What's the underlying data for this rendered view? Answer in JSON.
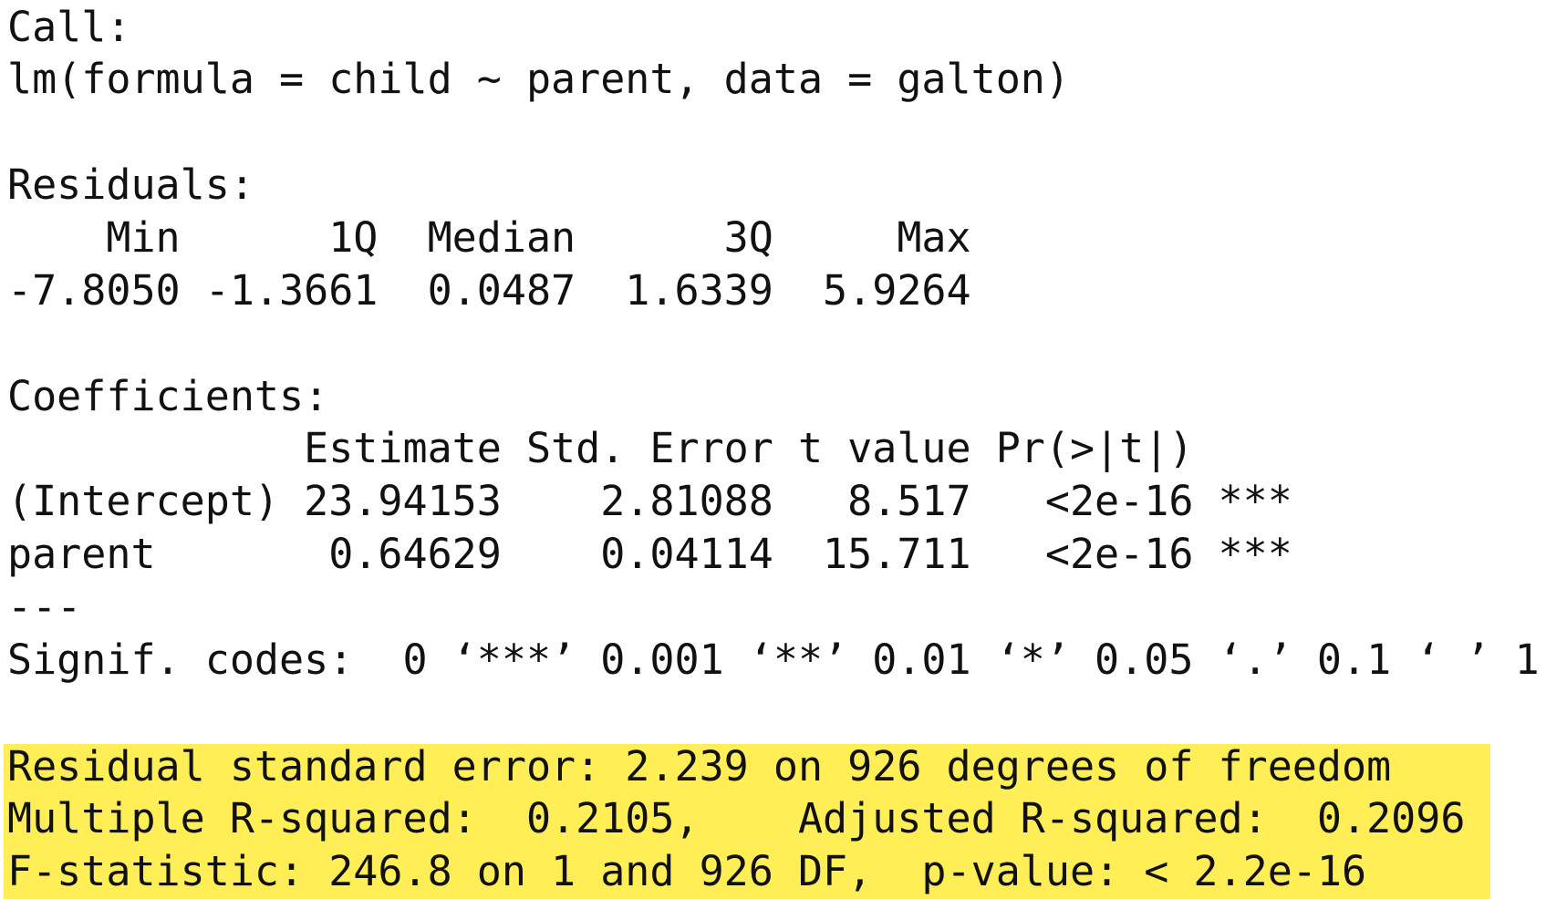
{
  "highlight_color": "#ffee55",
  "call": {
    "header": "Call:",
    "formula": "lm(formula = child ~ parent, data = galton)"
  },
  "residuals": {
    "header": "Residuals:",
    "labels_line": "    Min      1Q  Median      3Q     Max",
    "values_line": "-7.8050 -1.3661  0.0487  1.6339  5.9264",
    "stats": {
      "Min": -7.805,
      "1Q": -1.3661,
      "Median": 0.0487,
      "3Q": 1.6339,
      "Max": 5.9264
    }
  },
  "coefficients": {
    "header": "Coefficients:",
    "columns_line": "            Estimate Std. Error t value Pr(>|t|)",
    "rows": [
      {
        "line": "(Intercept) 23.94153    2.81088   8.517   <2e-16 ***",
        "term": "(Intercept)",
        "estimate": "23.94153",
        "std_error": "2.81088",
        "t_value": "8.517",
        "p": "<2e-16",
        "signif": "***"
      },
      {
        "line": "parent       0.64629    0.04114  15.711   <2e-16 ***",
        "term": "parent",
        "estimate": "0.64629",
        "std_error": "0.04114",
        "t_value": "15.711",
        "p": "<2e-16",
        "signif": "***"
      }
    ]
  },
  "separator": "---",
  "signif_codes": "Signif. codes:  0 ‘***’ 0.001 ‘**’ 0.01 ‘*’ 0.05 ‘.’ 0.1 ‘ ’ 1",
  "summary": {
    "residual_se": "Residual standard error: 2.239 on 926 degrees of freedom",
    "r_squared": "Multiple R-squared:  0.2105,    Adjusted R-squared:  0.2096",
    "f_statistic": "F-statistic: 246.8 on 1 and 926 DF,  p-value: < 2.2e-16"
  }
}
